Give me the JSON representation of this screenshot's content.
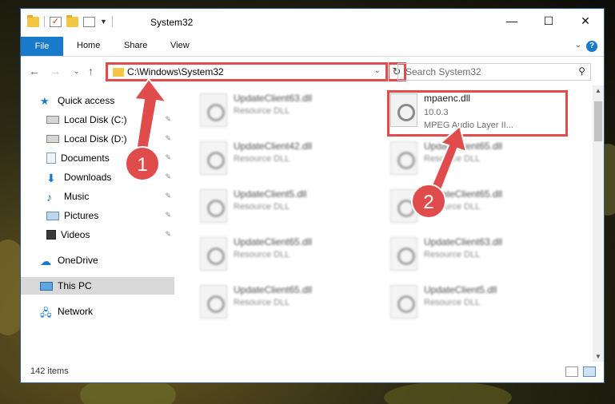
{
  "window": {
    "title": "System32",
    "minimize": "—",
    "maximize": "☐",
    "close": "✕"
  },
  "ribbon": {
    "file": "File",
    "home": "Home",
    "share": "Share",
    "view": "View",
    "help": "?"
  },
  "address": {
    "path": "C:\\Windows\\System32",
    "search_placeholder": "Search System32"
  },
  "sidebar": {
    "items": [
      {
        "label": "Quick access",
        "icon": "star-icon"
      },
      {
        "label": "Local Disk (C:)",
        "icon": "drive-icon"
      },
      {
        "label": "Local Disk (D:)",
        "icon": "drive-icon"
      },
      {
        "label": "Documents",
        "icon": "documents-icon"
      },
      {
        "label": "Downloads",
        "icon": "download-icon"
      },
      {
        "label": "Music",
        "icon": "music-icon"
      },
      {
        "label": "Pictures",
        "icon": "pictures-icon"
      },
      {
        "label": "Videos",
        "icon": "videos-icon"
      },
      {
        "label": "OneDrive",
        "icon": "cloud-icon"
      },
      {
        "label": "This PC",
        "icon": "computer-icon"
      },
      {
        "label": "Network",
        "icon": "network-icon"
      }
    ]
  },
  "files": [
    {
      "name": "UpdateClient63.dll",
      "sub": "Resource DLL"
    },
    {
      "name": "mpaenc.dll",
      "version": "10.0.3",
      "description": "MPEG Audio Layer II..."
    },
    {
      "name": "UpdateClient42.dll",
      "sub": "Resource DLL"
    },
    {
      "name": "UpdateClient65.dll",
      "sub": "Resource DLL"
    },
    {
      "name": "UpdateClient5.dll",
      "sub": "Resource DLL"
    },
    {
      "name": "UpdateClient65.dll",
      "sub": "Resource DLL"
    },
    {
      "name": "UpdateClient65.dll",
      "sub": "Resource DLL"
    },
    {
      "name": "UpdateClient63.dll",
      "sub": "Resource DLL"
    },
    {
      "name": "UpdateClient65.dll",
      "sub": "Resource DLL"
    },
    {
      "name": "UpdateClient5.dll",
      "sub": "Resource DLL"
    }
  ],
  "status": {
    "items": "142 items"
  },
  "annotations": {
    "step1": "1",
    "step2": "2",
    "color": "#e04b4b"
  }
}
